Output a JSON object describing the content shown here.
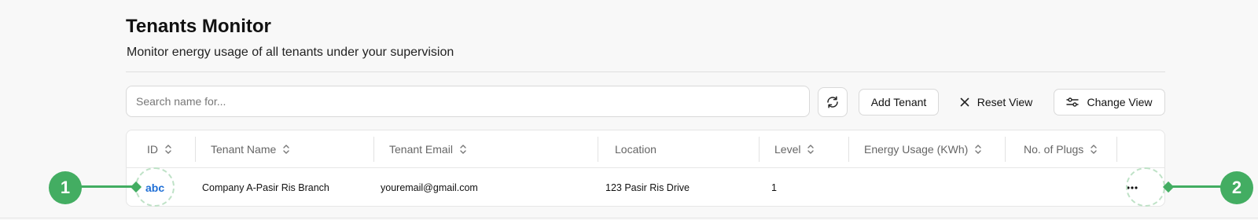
{
  "header": {
    "title": "Tenants Monitor",
    "subtitle": "Monitor energy usage of all tenants under your supervision"
  },
  "toolbar": {
    "search_placeholder": "Search name for...",
    "refresh_icon": "refresh-icon",
    "add_label": "Add Tenant",
    "reset_label": "Reset View",
    "reset_icon": "x-icon",
    "change_label": "Change View",
    "change_icon": "sliders-icon"
  },
  "table": {
    "columns": [
      {
        "label": "ID",
        "sortable": true
      },
      {
        "label": "Tenant Name",
        "sortable": true
      },
      {
        "label": "Tenant Email",
        "sortable": true
      },
      {
        "label": "Location",
        "sortable": false
      },
      {
        "label": "Level",
        "sortable": true
      },
      {
        "label": "Energy Usage (KWh)",
        "sortable": true
      },
      {
        "label": "No. of Plugs",
        "sortable": true
      }
    ],
    "rows": [
      {
        "id": "abc",
        "name": "Company A-Pasir Ris Branch",
        "email": "youremail@gmail.com",
        "location": "123 Pasir Ris Drive",
        "level": "1",
        "energy": "",
        "plugs": "",
        "actions_icon": "more-horizontal-icon"
      }
    ]
  },
  "annotations": [
    {
      "label": "1"
    },
    {
      "label": "2"
    }
  ],
  "colors": {
    "accent_link": "#1f6fd6",
    "callout_green": "#43ad62",
    "callout_ring": "#bfe2c7"
  }
}
